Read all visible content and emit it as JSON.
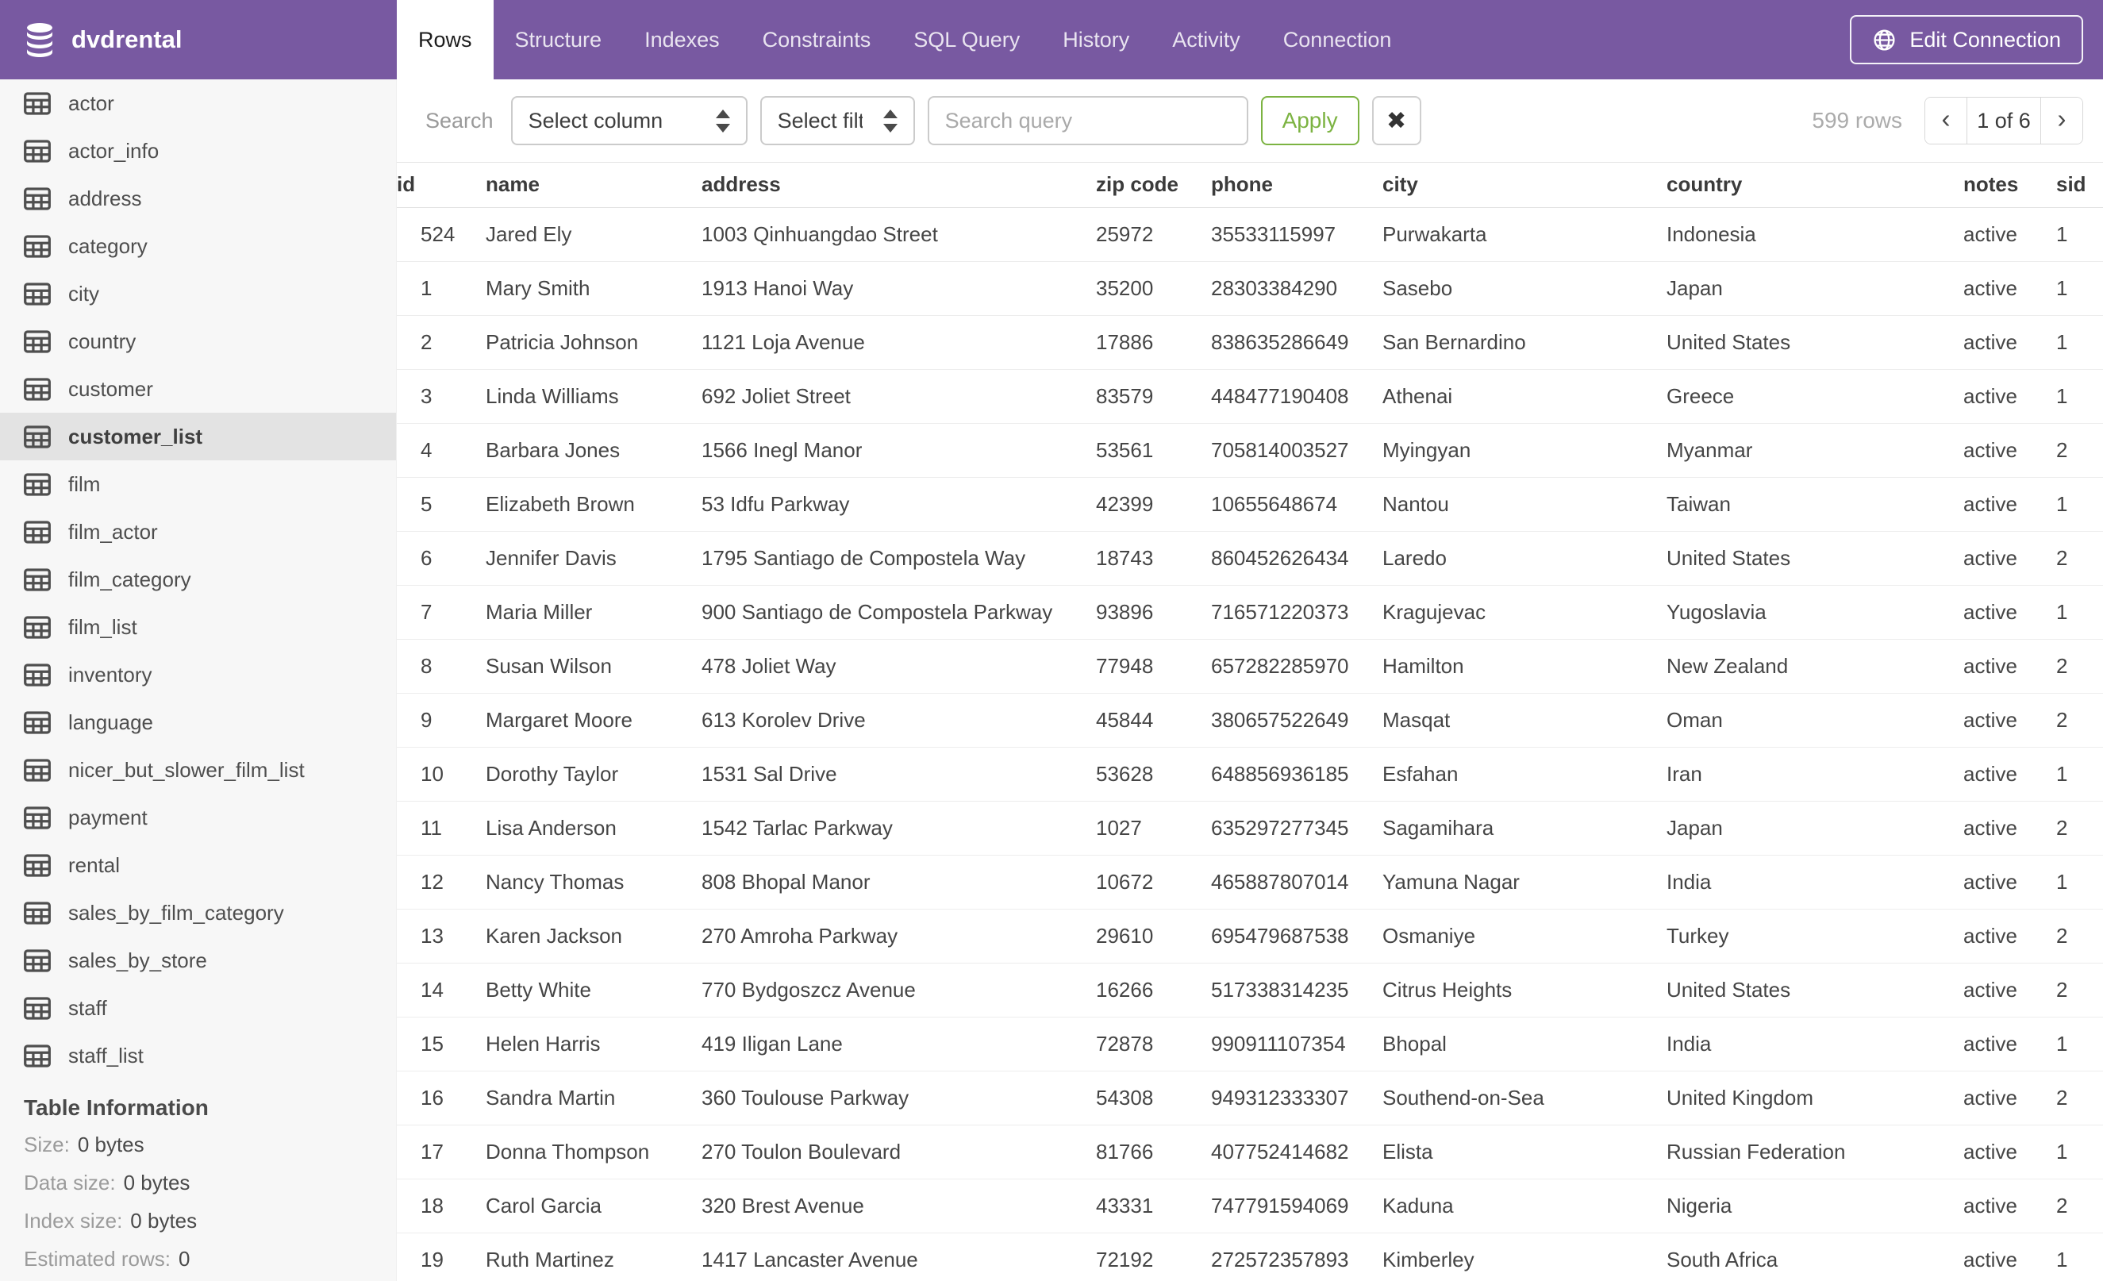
{
  "header": {
    "app_title": "dvdrental",
    "tabs": [
      {
        "label": "Rows",
        "active": true
      },
      {
        "label": "Structure"
      },
      {
        "label": "Indexes"
      },
      {
        "label": "Constraints"
      },
      {
        "label": "SQL Query"
      },
      {
        "label": "History"
      },
      {
        "label": "Activity"
      },
      {
        "label": "Connection"
      }
    ],
    "edit_connection_label": "Edit Connection"
  },
  "sidebar": {
    "tables": [
      {
        "label": "actor"
      },
      {
        "label": "actor_info"
      },
      {
        "label": "address"
      },
      {
        "label": "category"
      },
      {
        "label": "city"
      },
      {
        "label": "country"
      },
      {
        "label": "customer"
      },
      {
        "label": "customer_list",
        "selected": true
      },
      {
        "label": "film"
      },
      {
        "label": "film_actor"
      },
      {
        "label": "film_category"
      },
      {
        "label": "film_list"
      },
      {
        "label": "inventory"
      },
      {
        "label": "language"
      },
      {
        "label": "nicer_but_slower_film_list"
      },
      {
        "label": "payment"
      },
      {
        "label": "rental"
      },
      {
        "label": "sales_by_film_category"
      },
      {
        "label": "sales_by_store"
      },
      {
        "label": "staff"
      },
      {
        "label": "staff_list"
      }
    ],
    "table_information": {
      "title": "Table Information",
      "rows": [
        {
          "label": "Size:",
          "value": "0 bytes"
        },
        {
          "label": "Data size:",
          "value": "0 bytes"
        },
        {
          "label": "Index size:",
          "value": "0 bytes"
        },
        {
          "label": "Estimated rows:",
          "value": "0"
        }
      ]
    }
  },
  "toolbar": {
    "search_label": "Search",
    "column_select_value": "Select column",
    "filter_select_value": "Select filter",
    "query_placeholder": "Search query",
    "apply_label": "Apply",
    "clear_glyph": "✖",
    "rows_count": "599 rows",
    "pagination": {
      "prev": "‹",
      "current": "1 of 6",
      "next": "›"
    }
  },
  "table": {
    "columns": [
      "id",
      "name",
      "address",
      "zip code",
      "phone",
      "city",
      "country",
      "notes",
      "sid"
    ],
    "rows": [
      {
        "id": "524",
        "name": "Jared Ely",
        "address": "1003 Qinhuangdao Street",
        "zip": "25972",
        "phone": "35533115997",
        "city": "Purwakarta",
        "country": "Indonesia",
        "notes": "active",
        "sid": "1"
      },
      {
        "id": "1",
        "name": "Mary Smith",
        "address": "1913 Hanoi Way",
        "zip": "35200",
        "phone": "28303384290",
        "city": "Sasebo",
        "country": "Japan",
        "notes": "active",
        "sid": "1"
      },
      {
        "id": "2",
        "name": "Patricia Johnson",
        "address": "1121 Loja Avenue",
        "zip": "17886",
        "phone": "838635286649",
        "city": "San Bernardino",
        "country": "United States",
        "notes": "active",
        "sid": "1"
      },
      {
        "id": "3",
        "name": "Linda Williams",
        "address": "692 Joliet Street",
        "zip": "83579",
        "phone": "448477190408",
        "city": "Athenai",
        "country": "Greece",
        "notes": "active",
        "sid": "1"
      },
      {
        "id": "4",
        "name": "Barbara Jones",
        "address": "1566 Inegl Manor",
        "zip": "53561",
        "phone": "705814003527",
        "city": "Myingyan",
        "country": "Myanmar",
        "notes": "active",
        "sid": "2"
      },
      {
        "id": "5",
        "name": "Elizabeth Brown",
        "address": "53 Idfu Parkway",
        "zip": "42399",
        "phone": "10655648674",
        "city": "Nantou",
        "country": "Taiwan",
        "notes": "active",
        "sid": "1"
      },
      {
        "id": "6",
        "name": "Jennifer Davis",
        "address": "1795 Santiago de Compostela Way",
        "zip": "18743",
        "phone": "860452626434",
        "city": "Laredo",
        "country": "United States",
        "notes": "active",
        "sid": "2"
      },
      {
        "id": "7",
        "name": "Maria Miller",
        "address": "900 Santiago de Compostela Parkway",
        "zip": "93896",
        "phone": "716571220373",
        "city": "Kragujevac",
        "country": "Yugoslavia",
        "notes": "active",
        "sid": "1"
      },
      {
        "id": "8",
        "name": "Susan Wilson",
        "address": "478 Joliet Way",
        "zip": "77948",
        "phone": "657282285970",
        "city": "Hamilton",
        "country": "New Zealand",
        "notes": "active",
        "sid": "2"
      },
      {
        "id": "9",
        "name": "Margaret Moore",
        "address": "613 Korolev Drive",
        "zip": "45844",
        "phone": "380657522649",
        "city": "Masqat",
        "country": "Oman",
        "notes": "active",
        "sid": "2"
      },
      {
        "id": "10",
        "name": "Dorothy Taylor",
        "address": "1531 Sal Drive",
        "zip": "53628",
        "phone": "648856936185",
        "city": "Esfahan",
        "country": "Iran",
        "notes": "active",
        "sid": "1"
      },
      {
        "id": "11",
        "name": "Lisa Anderson",
        "address": "1542 Tarlac Parkway",
        "zip": "1027",
        "phone": "635297277345",
        "city": "Sagamihara",
        "country": "Japan",
        "notes": "active",
        "sid": "2"
      },
      {
        "id": "12",
        "name": "Nancy Thomas",
        "address": "808 Bhopal Manor",
        "zip": "10672",
        "phone": "465887807014",
        "city": "Yamuna Nagar",
        "country": "India",
        "notes": "active",
        "sid": "1"
      },
      {
        "id": "13",
        "name": "Karen Jackson",
        "address": "270 Amroha Parkway",
        "zip": "29610",
        "phone": "695479687538",
        "city": "Osmaniye",
        "country": "Turkey",
        "notes": "active",
        "sid": "2"
      },
      {
        "id": "14",
        "name": "Betty White",
        "address": "770 Bydgoszcz Avenue",
        "zip": "16266",
        "phone": "517338314235",
        "city": "Citrus Heights",
        "country": "United States",
        "notes": "active",
        "sid": "2"
      },
      {
        "id": "15",
        "name": "Helen Harris",
        "address": "419 Iligan Lane",
        "zip": "72878",
        "phone": "990911107354",
        "city": "Bhopal",
        "country": "India",
        "notes": "active",
        "sid": "1"
      },
      {
        "id": "16",
        "name": "Sandra Martin",
        "address": "360 Toulouse Parkway",
        "zip": "54308",
        "phone": "949312333307",
        "city": "Southend-on-Sea",
        "country": "United Kingdom",
        "notes": "active",
        "sid": "2"
      },
      {
        "id": "17",
        "name": "Donna Thompson",
        "address": "270 Toulon Boulevard",
        "zip": "81766",
        "phone": "407752414682",
        "city": "Elista",
        "country": "Russian Federation",
        "notes": "active",
        "sid": "1"
      },
      {
        "id": "18",
        "name": "Carol Garcia",
        "address": "320 Brest Avenue",
        "zip": "43331",
        "phone": "747791594069",
        "city": "Kaduna",
        "country": "Nigeria",
        "notes": "active",
        "sid": "2"
      },
      {
        "id": "19",
        "name": "Ruth Martinez",
        "address": "1417 Lancaster Avenue",
        "zip": "72192",
        "phone": "272572357893",
        "city": "Kimberley",
        "country": "South Africa",
        "notes": "active",
        "sid": "1"
      }
    ]
  },
  "colors": {
    "brand_purple": "#7859A1",
    "apply_green": "#7CB342"
  }
}
